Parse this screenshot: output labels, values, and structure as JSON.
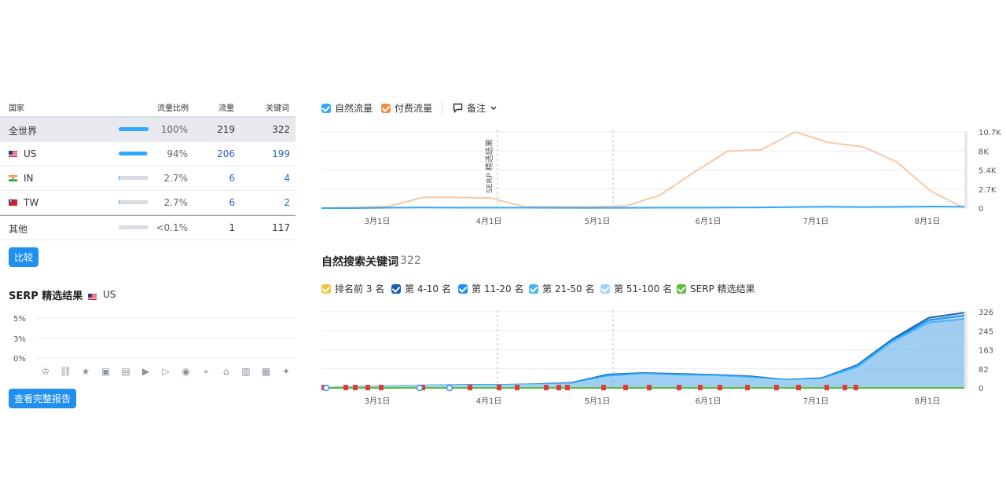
{
  "table": {
    "headers": {
      "country": "国家",
      "share": "流量比例",
      "traffic": "流量",
      "keywords": "关键词"
    },
    "rows": [
      {
        "name": "全世界",
        "flag": "",
        "share": "100%",
        "share_frac": 1.0,
        "traffic": "219",
        "keywords": "322",
        "selected": true
      },
      {
        "name": "US",
        "flag": "us-flag",
        "share": "94%",
        "share_frac": 0.94,
        "traffic": "206",
        "keywords": "199"
      },
      {
        "name": "IN",
        "flag": "in-flag",
        "share": "2.7%",
        "share_frac": 0.027,
        "traffic": "6",
        "keywords": "4"
      },
      {
        "name": "TW",
        "flag": "tw-flag",
        "share": "2.7%",
        "share_frac": 0.027,
        "traffic": "6",
        "keywords": "2"
      },
      {
        "name": "其他",
        "flag": "",
        "share": "<0.1%",
        "share_frac": 0.001,
        "traffic": "1",
        "keywords": "117"
      }
    ],
    "compare_button": "比较"
  },
  "serp": {
    "title": "SERP 精选结果",
    "country": "US",
    "yticks": [
      "5%",
      "3%",
      "0%"
    ],
    "icons": [
      "crown-icon",
      "link-icon",
      "star-icon",
      "image-icon",
      "gallery-icon",
      "video-play-icon",
      "video-icon",
      "play-icon",
      "location-icon",
      "graduation-cap-icon",
      "document-icon",
      "briefcase-icon",
      "twitter-icon"
    ],
    "full_report_button": "查看完整报告"
  },
  "traffic_legend": {
    "organic": "自然流量",
    "paid": "付费流量",
    "notes": "备注",
    "organic_color": "#2fa8ff",
    "paid_color": "#f08a3c"
  },
  "keywords_section": {
    "title": "自然搜索关键词",
    "count": "322",
    "legend": [
      {
        "label": "排名前 3 名",
        "color": "#f5c242"
      },
      {
        "label": "第 4-10 名",
        "color": "#1560b5"
      },
      {
        "label": "第 11-20 名",
        "color": "#1f8ff0"
      },
      {
        "label": "第 21-50 名",
        "color": "#46b4f5"
      },
      {
        "label": "第 51-100 名",
        "color": "#9fd4f7"
      },
      {
        "label": "SERP 精选结果",
        "color": "#5cbf3a"
      }
    ]
  },
  "chart_data": [
    {
      "type": "line",
      "x": [
        "3月1日",
        "4月1日",
        "5月1日",
        "6月1日",
        "7月1日",
        "8月1日"
      ],
      "yticks": [
        "10.7K",
        "8K",
        "5.4K",
        "2.7K",
        "0"
      ],
      "ylim": [
        0,
        10700
      ],
      "annotation": "SERP 精选结果",
      "series": [
        {
          "name": "自然流量",
          "color": "#2fa8ff",
          "values": [
            0,
            0,
            50,
            80,
            60,
            60,
            50,
            40,
            30,
            40,
            50,
            60,
            80,
            100,
            150,
            200,
            150,
            180,
            220,
            200
          ]
        },
        {
          "name": "付费流量",
          "color": "#f9c7a8",
          "values": [
            0,
            100,
            250,
            1500,
            1500,
            1400,
            200,
            200,
            200,
            300,
            1800,
            5000,
            8000,
            8200,
            10700,
            9200,
            8600,
            6500,
            2400,
            0
          ]
        }
      ]
    },
    {
      "type": "area",
      "x": [
        "3月1日",
        "4月1日",
        "5月1日",
        "6月1日",
        "7月1日",
        "8月1日"
      ],
      "yticks": [
        "326",
        "245",
        "163",
        "82",
        "0"
      ],
      "ylim": [
        0,
        326
      ],
      "series": [
        {
          "name": "第 51-100 名",
          "color": "#9fd4f7",
          "values": [
            0,
            5,
            8,
            10,
            10,
            10,
            12,
            15,
            45,
            55,
            50,
            48,
            40,
            30,
            35,
            80,
            150,
            210,
            215
          ]
        },
        {
          "name": "第 21-50 名",
          "color": "#46b4f5",
          "values": [
            0,
            5,
            8,
            10,
            12,
            12,
            14,
            18,
            50,
            60,
            55,
            52,
            45,
            32,
            38,
            90,
            200,
            280,
            295
          ]
        },
        {
          "name": "第 11-20 名",
          "color": "#1f8ff0",
          "values": [
            0,
            5,
            8,
            10,
            12,
            12,
            15,
            20,
            55,
            62,
            58,
            54,
            48,
            34,
            40,
            95,
            205,
            290,
            310
          ]
        },
        {
          "name": "第 4-10 名",
          "color": "#1560b5",
          "values": [
            0,
            6,
            9,
            11,
            13,
            13,
            16,
            22,
            57,
            64,
            60,
            56,
            50,
            35,
            42,
            98,
            210,
            300,
            322
          ]
        }
      ]
    }
  ]
}
